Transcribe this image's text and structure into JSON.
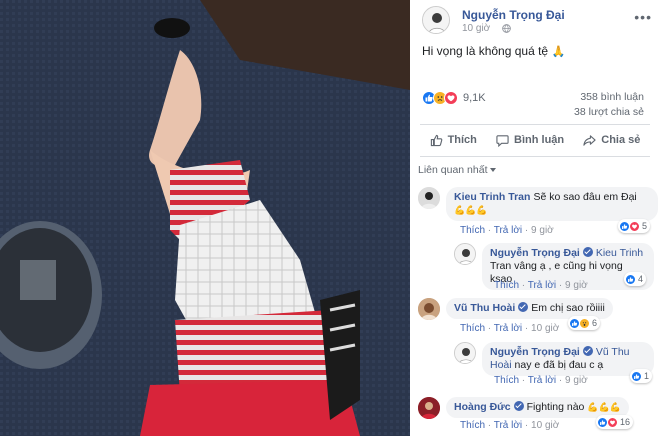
{
  "post": {
    "author": "Nguyễn Trọng Đại",
    "time": "10 giờ",
    "text": "Hi vọng là không quá tệ",
    "text_emoji": "🙏",
    "reaction_count": "9,1K",
    "comment_count": "358 bình luận",
    "share_count": "38 lượt chia sẻ"
  },
  "actions": {
    "like": "Thích",
    "comment": "Bình luận",
    "share": "Chia sẻ"
  },
  "sort_label": "Liên quan nhất",
  "comments": [
    {
      "name": "Kieu Trinh Tran",
      "text": "Sẽ ko sao đâu em Đại",
      "emoji": "💪💪💪",
      "like": "Thích",
      "reply": "Trả lời",
      "time": "9 giờ",
      "reactions": "5"
    },
    {
      "name": "Nguyễn Trọng Đại",
      "tag": "Kieu Trinh",
      "text_line1": "Tran vâng ạ , e cũng hi vọng ksao",
      "like": "Thích",
      "reply": "Trả lời",
      "time": "9 giờ",
      "reactions": "4"
    },
    {
      "name": "Vũ Thu Hoài",
      "text": "Em chị sao rồiiii",
      "like": "Thích",
      "reply": "Trả lời",
      "time": "10 giờ",
      "reactions": "6"
    },
    {
      "name": "Nguyễn Trọng Đại",
      "tag": "Vũ Thu Hoài",
      "text_line1": "nay e đã bị đau c ạ",
      "like": "Thích",
      "reply": "Trả lời",
      "time": "9 giờ",
      "reactions": "1"
    },
    {
      "name": "Hoàng Đức",
      "text": "Fighting nào",
      "emoji": "💪💪💪",
      "like": "Thích",
      "reply": "Trả lời",
      "time": "10 giờ",
      "reactions": "16"
    }
  ],
  "colors": {
    "link_blue": "#385898",
    "like_blue": "#1877f2",
    "love_red": "#f33e58",
    "haha_yellow": "#f7b125",
    "muted": "#90949c"
  },
  "icons": [
    "globe-icon",
    "more-icon",
    "like-icon",
    "love-icon",
    "sad-icon",
    "comment-icon",
    "share-icon",
    "verified-icon"
  ]
}
